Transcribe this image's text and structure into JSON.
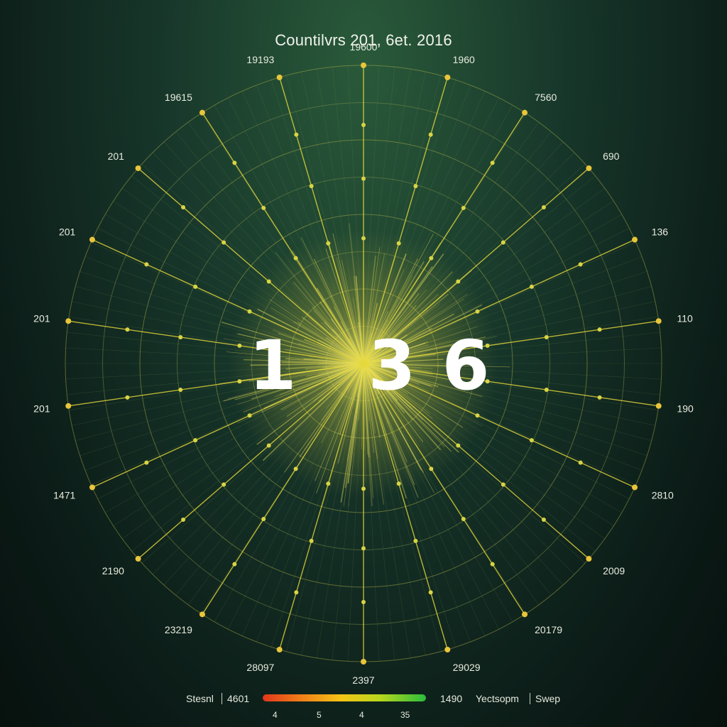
{
  "chart_data": {
    "type": "radial",
    "title": "Countilvrs 201, 6et. 2016",
    "spoke_labels": [
      "19600",
      "1960",
      "7560",
      "690",
      "136",
      "110",
      "190",
      "2810",
      "2009",
      "20179",
      "29029",
      "2397",
      "28097",
      "23219",
      "2190",
      "1471",
      "201",
      "201",
      "201",
      "201",
      "19615",
      "19193"
    ],
    "center_values": [
      "1",
      "3",
      "6"
    ],
    "rings": 8,
    "color_scale": {
      "ticks": [
        "4",
        "5",
        "4",
        "35"
      ],
      "colors": [
        "#e2361c",
        "#f07a18",
        "#f5c516",
        "#b7d81d",
        "#2bbd3d"
      ]
    },
    "grid": true,
    "accent_color": "#e6d83a"
  },
  "legend": {
    "left_label": "Stesnl",
    "left_value": "4601",
    "right_value": "1490",
    "right_label": "Yectsopm",
    "right_extra": "Swep"
  }
}
